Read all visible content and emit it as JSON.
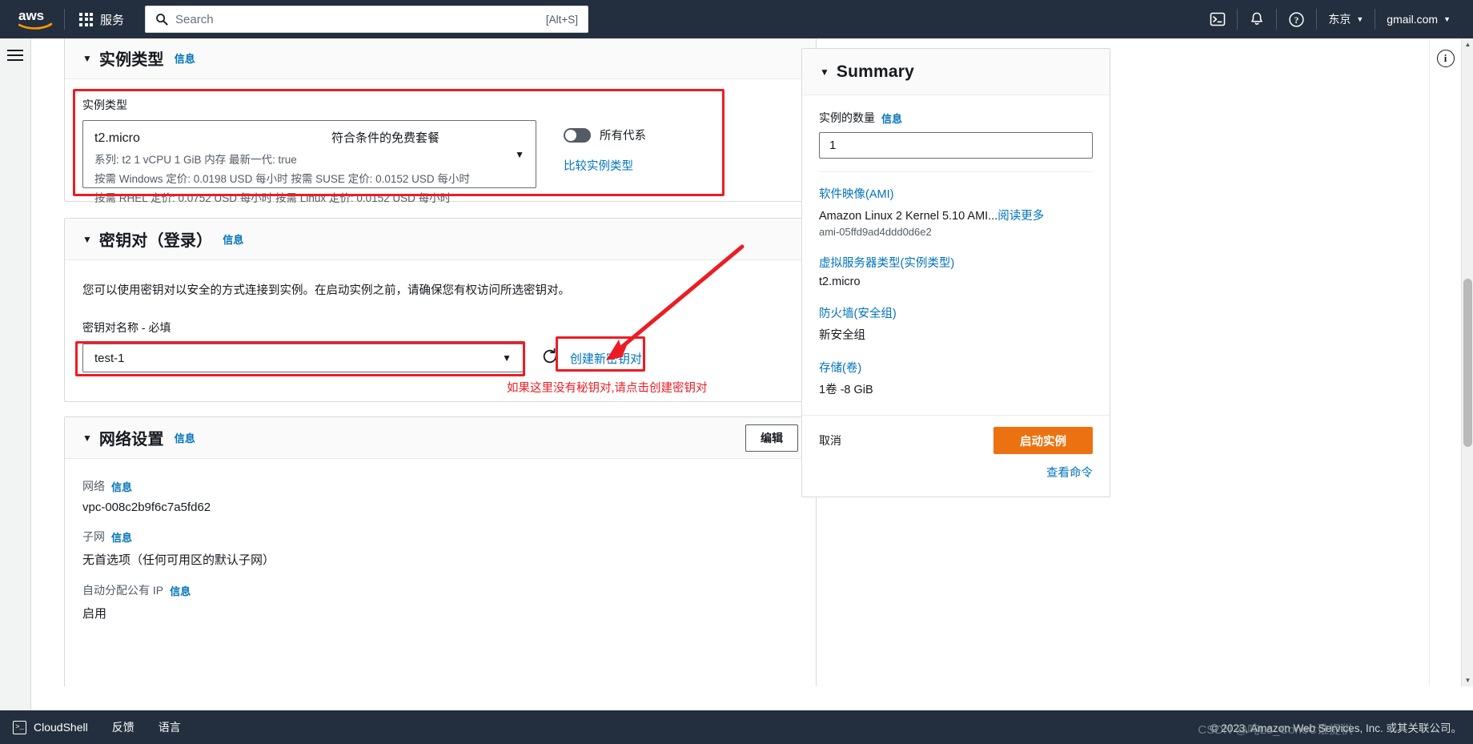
{
  "topnav": {
    "logo_alt": "aws",
    "services_label": "服务",
    "search": {
      "placeholder": "Search",
      "value": "",
      "shortcut": "[Alt+S]"
    },
    "region": "东京",
    "account": "gmail.com"
  },
  "instance_type_section": {
    "title": "实例类型",
    "info": "信息",
    "field_label": "实例类型",
    "selected": {
      "name": "t2.micro",
      "free_tier": "符合条件的免费套餐",
      "spec": "系列: t2    1 vCPU    1 GiB 内存    最新一代: true",
      "price_line_1": "按需 Windows 定价: 0.0198 USD 每小时    按需 SUSE 定价: 0.0152 USD 每小时",
      "price_line_2": "按需 RHEL 定价: 0.0752 USD 每小时    按需 Linux 定价: 0.0152 USD 每小时"
    },
    "toggle_label": "所有代系",
    "toggle_state": "off",
    "compare_link": "比较实例类型"
  },
  "key_pair_section": {
    "title": "密钥对（登录）",
    "info": "信息",
    "description": "您可以使用密钥对以安全的方式连接到实例。在启动实例之前，请确保您有权访问所选密钥对。",
    "field_label": "密钥对名称 - 必填",
    "selected_value": "test-1",
    "refresh_icon": "refresh-icon",
    "create_link": "创建新密钥对"
  },
  "network_section": {
    "title": "网络设置",
    "info": "信息",
    "edit_button": "编辑",
    "rows": [
      {
        "label": "网络",
        "info": "信息",
        "value": "vpc-008c2b9f6c7a5fd62"
      },
      {
        "label": "子网",
        "info": "信息",
        "value": "无首选项（任何可用区的默认子网）"
      },
      {
        "label": "自动分配公有 IP",
        "info": "信息",
        "value": "启用"
      }
    ]
  },
  "summary": {
    "title": "Summary",
    "count_label": "实例的数量",
    "count_info": "信息",
    "count_value": "1",
    "items": [
      {
        "link": "软件映像(AMI)",
        "value": "Amazon Linux 2 Kernel 5.10 AMI...",
        "value_more": "阅读更多",
        "sub": "ami-05ffd9ad4ddd0d6e2"
      },
      {
        "link": "虚拟服务器类型(实例类型)",
        "value": "t2.micro",
        "sub": ""
      },
      {
        "link": "防火墙(安全组)",
        "value": "新安全组",
        "sub": ""
      },
      {
        "link": "存储(卷)",
        "value": "1卷 -8 GiB",
        "sub": ""
      }
    ],
    "cancel_label": "取消",
    "launch_label": "启动实例",
    "view_command_label": "查看命令"
  },
  "annotations": {
    "keypair_note": "如果这里没有秘钥对,请点击创建密钥对",
    "highlight_color": "#ed1c24"
  },
  "footer": {
    "cloudshell": "CloudShell",
    "feedback": "反馈",
    "language": "语言",
    "copyright": "© 2023, Amazon Web Services, Inc. 或其关联公司。",
    "watermark": "CSDN @吨Lo_ConeC谁提供"
  }
}
